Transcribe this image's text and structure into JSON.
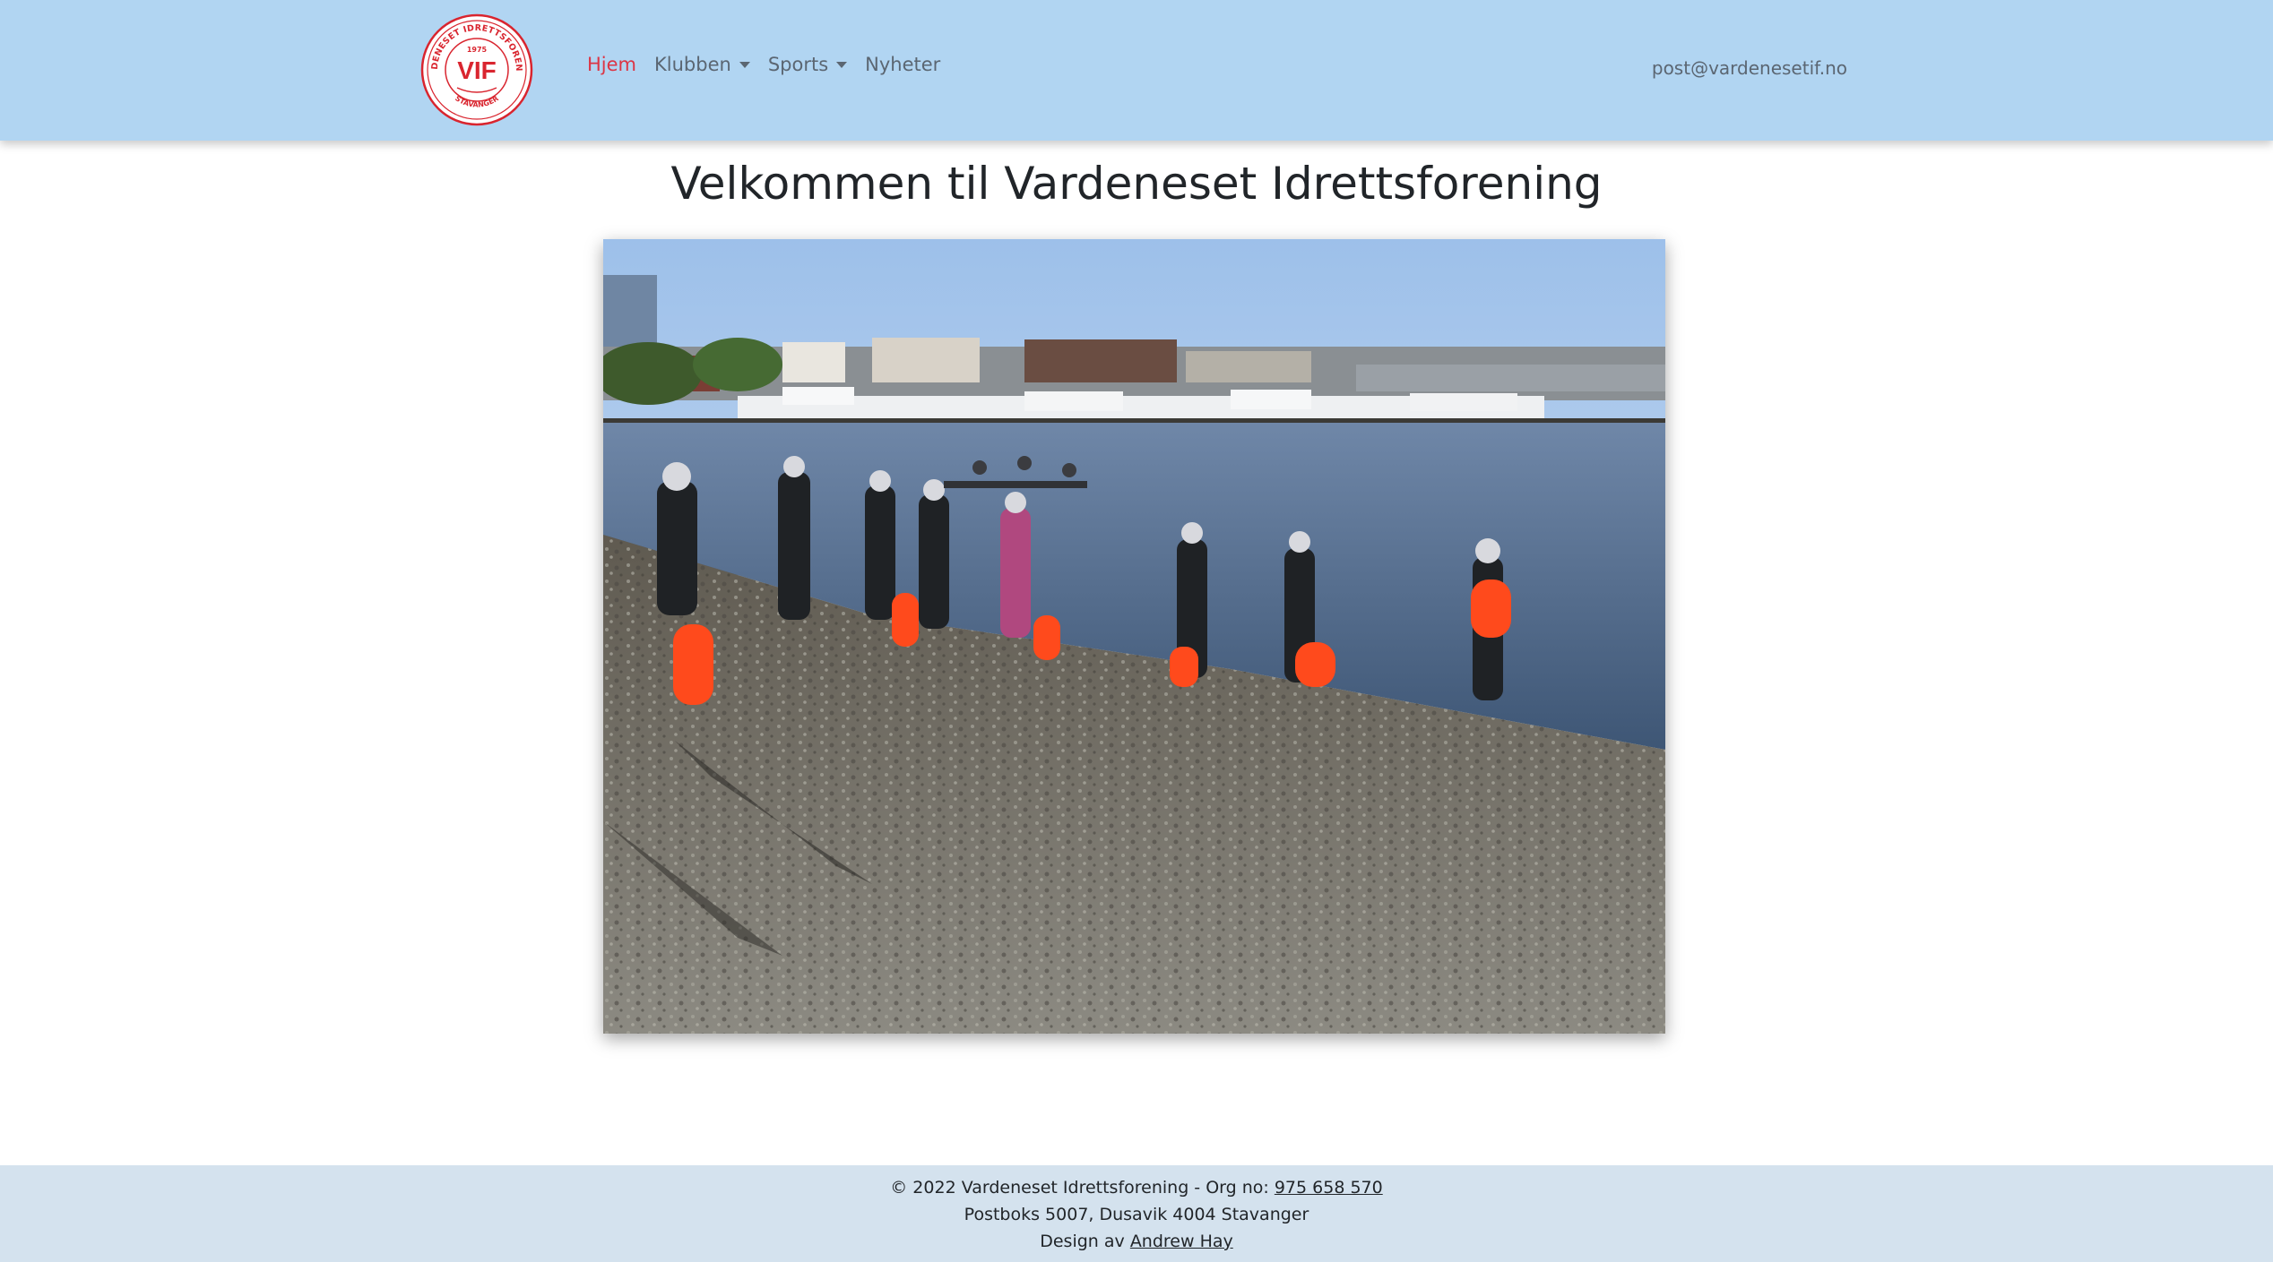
{
  "nav": {
    "logo": {
      "year": "1975",
      "initials": "VIF",
      "ring_top": "VARDENESET IDRETTSFORENING",
      "ring_bottom": "STAVANGER"
    },
    "links": [
      {
        "label": "Hjem",
        "active": true,
        "dropdown": false
      },
      {
        "label": "Klubben",
        "active": false,
        "dropdown": true
      },
      {
        "label": "Sports",
        "active": false,
        "dropdown": true
      },
      {
        "label": "Nyheter",
        "active": false,
        "dropdown": false
      }
    ],
    "email": "post@vardenesetif.no"
  },
  "main": {
    "title": "Velkommen til Vardeneset Idrettsforening"
  },
  "footer": {
    "copyright": "© 2022 Vardeneset Idrettsforening - Org no: ",
    "org_no": "975 658 570",
    "address": "Postboks 5007, Dusavik 4004 Stavanger",
    "design_prefix": "Design av ",
    "designer": "Andrew Hay"
  },
  "colors": {
    "navbar_bg": "#b1d5f2",
    "active_link": "#dc3545",
    "footer_bg": "#d4e2ee",
    "logo_red": "#d9252f"
  }
}
